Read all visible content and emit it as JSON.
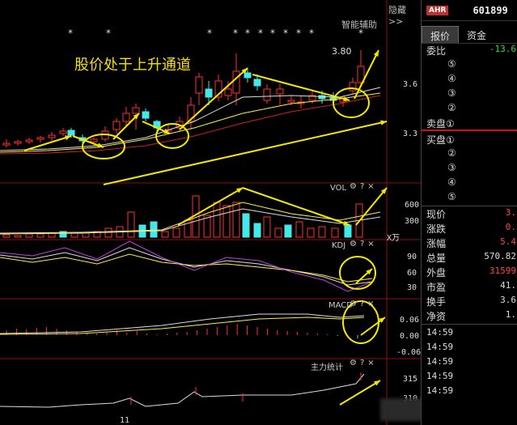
{
  "header": {
    "hide_label": "隐藏",
    "hide_arrow": ">>",
    "smart_assist": "智能辅助"
  },
  "annotation": {
    "title": "股价处于上升通道",
    "high_price": "3.80"
  },
  "stars": [
    "*",
    "*",
    "*",
    "*",
    "*",
    "*",
    "*",
    "*",
    "*",
    "*",
    "*",
    "*"
  ],
  "price_axis": {
    "labels": [
      "3.6",
      "3.3"
    ]
  },
  "volume": {
    "name": "VOL",
    "axis_labels": [
      "600",
      "300"
    ],
    "unit": "X万"
  },
  "kdj": {
    "name": "KDJ",
    "axis_labels": [
      "90",
      "60",
      "30"
    ]
  },
  "macd": {
    "name": "MACD",
    "axis_labels": [
      "0.06",
      "0.00",
      "-0.06"
    ]
  },
  "main_force": {
    "name": "主力统计",
    "axis_labels": [
      "315",
      "310"
    ]
  },
  "bottom_tick": "11",
  "indicator_icons": {
    "gear": "⚙",
    "help": "?",
    "close": "×"
  },
  "panel": {
    "market": "AHR",
    "code": "601899",
    "tabs": [
      "报价",
      "资金"
    ],
    "weibi_label": "委比",
    "weibi_value": "-13.6",
    "sell_levels": [
      "⑤",
      "④",
      "③",
      "②"
    ],
    "sell_label": "卖盘①",
    "buy_label": "买盘①",
    "buy_levels": [
      "②",
      "③",
      "④",
      "⑤"
    ],
    "quote_rows": [
      {
        "label": "现价",
        "value": "3.",
        "color": "red"
      },
      {
        "label": "涨跌",
        "value": "0.",
        "color": "red"
      },
      {
        "label": "涨幅",
        "value": "5.4",
        "color": "red"
      },
      {
        "label": "总量",
        "value": "570.82",
        "color": "white"
      },
      {
        "label": "外盘",
        "value": "31599",
        "color": "red"
      },
      {
        "label": "市盈",
        "value": "41.",
        "color": "white"
      },
      {
        "label": "换手",
        "value": "3.6",
        "color": "white"
      },
      {
        "label": "净资",
        "value": "1.",
        "color": "white"
      }
    ],
    "times": [
      "14:59",
      "14:59",
      "14:59",
      "14:59",
      "14:59"
    ]
  }
}
